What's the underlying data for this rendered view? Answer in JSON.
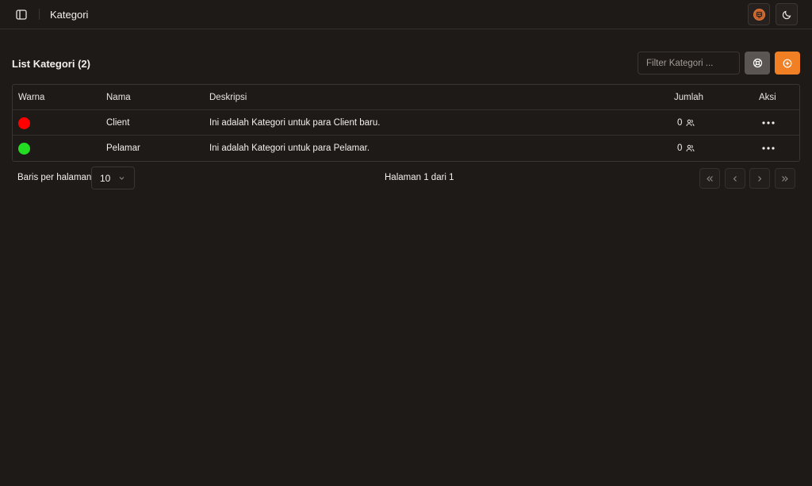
{
  "header": {
    "title": "Kategori",
    "icons": {
      "sidebar_toggle": "panel-left-icon",
      "avatar": "avatar-icon",
      "theme": "moon-icon"
    }
  },
  "toolbar": {
    "title": "List Kategori (2)",
    "filter_placeholder": "Filter Kategori ...",
    "reset_icon": "reset-icon",
    "add_icon": "plus-circle-icon"
  },
  "table": {
    "columns": [
      "Warna",
      "Nama",
      "Deskripsi",
      "Jumlah",
      "Aksi"
    ],
    "rows": [
      {
        "color": "#ff0000",
        "name": "Client",
        "description": "Ini adalah Kategori untuk para Client baru.",
        "count": "0"
      },
      {
        "color": "#22dd22",
        "name": "Pelamar",
        "description": "Ini adalah Kategori untuk para Pelamar.",
        "count": "0"
      }
    ],
    "count_icon": "users-icon",
    "action_icon": "more-horizontal-icon"
  },
  "pagination": {
    "rows_label": "Baris per halaman",
    "rows_value": "10",
    "page_info": "Halaman 1 dari 1"
  },
  "colors": {
    "background": "#1e1a17",
    "accent": "#f08023",
    "border": "#3b3633"
  }
}
